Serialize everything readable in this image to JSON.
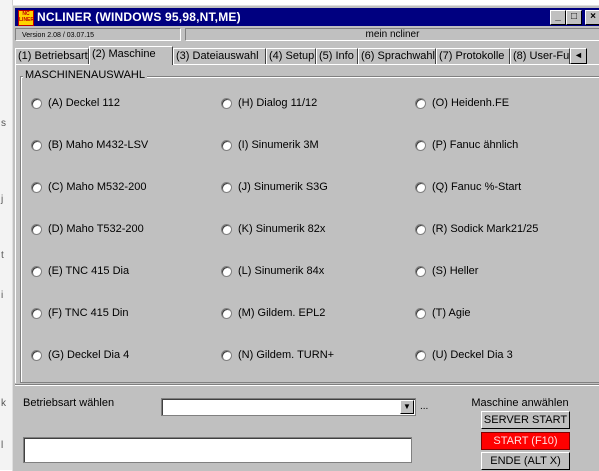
{
  "window": {
    "title": "NCLINER (WINDOWS 95,98,NT,ME)",
    "app_icon_text": "NC LINER",
    "version": "Version 2.08 / 03.07.15",
    "center_title": "mein ncliner",
    "controls": {
      "minimize": "_",
      "maximize": "□",
      "close": "×"
    }
  },
  "left_strip_glyphs": [
    "s",
    "j",
    "t",
    "i",
    "k",
    "l"
  ],
  "tabs": [
    "(1) Betriebsart",
    "(2) Maschine",
    "(3) Dateiauswahl",
    "(4) Setup",
    "(5) Info",
    "(6) Sprachwahl",
    "(7) Protokolle",
    "(8) User-Fu"
  ],
  "tab_scroll": "◄",
  "active_tab": "(2) Maschine",
  "group_label": "MASCHINENAUSWAHL",
  "machines": [
    [
      "(A) Deckel 112",
      "(H) Dialog 11/12",
      "(O) Heidenh.FE"
    ],
    [
      "(B) Maho M432-LSV",
      "(I) Sinumerik 3M",
      "(P) Fanuc ähnlich"
    ],
    [
      "(C) Maho M532-200",
      "(J) Sinumerik S3G",
      "(Q) Fanuc %-Start"
    ],
    [
      "(D) Maho T532-200",
      "(K) Sinumerik 82x",
      "(R) Sodick Mark21/25"
    ],
    [
      "(E) TNC 415 Dia",
      "(L) Sinumerik 84x",
      "(S) Heller"
    ],
    [
      "(F) TNC 415 Din",
      "(M) Gildem. EPL2",
      "(T) Agie"
    ],
    [
      "(G) Deckel Dia 4",
      "(N) Gildem. TURN+",
      "(U) Deckel Dia 3"
    ]
  ],
  "bottom": {
    "betriebsart_label": "Betriebsart wählen",
    "combo_value": "",
    "combo_arrow": "▼",
    "dots": "...",
    "maschine_label": "Maschine anwählen",
    "server_start": "SERVER START",
    "start": "START (F10)",
    "ende": "ENDE (ALT X)",
    "message": ""
  },
  "colors": {
    "titlebar": "#000080",
    "start_button": "#ff0000",
    "window_bg": "#c0c0c0"
  }
}
